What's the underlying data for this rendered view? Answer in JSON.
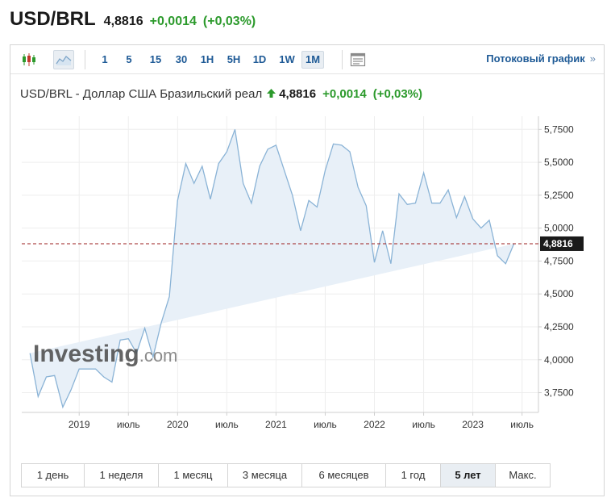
{
  "header": {
    "pair": "USD/BRL",
    "price": "4,8816",
    "change": "+0,0014",
    "change_pct": "(+0,03%)"
  },
  "toolbar": {
    "icons": [
      "candlestick-icon",
      "area-chart-icon"
    ],
    "active_icon": "area-chart-icon",
    "timeframes": [
      "1",
      "5",
      "15",
      "30",
      "1H",
      "5H",
      "1D",
      "1W",
      "1M"
    ],
    "active_timeframe": "1M",
    "settings_icon": "chart-settings-icon",
    "streaming_label": "Потоковый график",
    "streaming_chevron": "»"
  },
  "subtitle": {
    "name": "USD/BRL - Доллар США Бразильский реал",
    "arrow_icon": "up-arrow-icon",
    "price": "4,8816",
    "change": "+0,0014",
    "change_pct": "(+0,03%)"
  },
  "watermark": {
    "brand": "Investing",
    "suffix": ".com"
  },
  "ranges": {
    "items": [
      "1 день",
      "1 неделя",
      "1 месяц",
      "3 месяца",
      "6 месяцев",
      "1 год",
      "5 лет",
      "Макс."
    ],
    "active": "5 лет"
  },
  "colors": {
    "line": "#8ab3d6",
    "area": "#e8f0f8",
    "positive": "#2c9a2c",
    "link": "#1e5a96",
    "last_price_line": "#9b1c1c",
    "last_price_tag": "#1a1a1a"
  },
  "chart_data": {
    "type": "area",
    "ylim": [
      3.6,
      5.85
    ],
    "yticks": [
      3.75,
      4.0,
      4.25,
      4.5,
      4.75,
      5.0,
      5.25,
      5.5,
      5.75
    ],
    "ytick_labels": [
      "3,7500",
      "4,0000",
      "4,2500",
      "4,5000",
      "4,7500",
      "5,0000",
      "5,2500",
      "5,5000",
      "5,7500"
    ],
    "xlim": [
      "2018-06",
      "2023-09"
    ],
    "xticks": [
      {
        "label": "2019",
        "date": "2019-01"
      },
      {
        "label": "июль",
        "date": "2019-07"
      },
      {
        "label": "2020",
        "date": "2020-01"
      },
      {
        "label": "июль",
        "date": "2020-07"
      },
      {
        "label": "2021",
        "date": "2021-01"
      },
      {
        "label": "июль",
        "date": "2021-07"
      },
      {
        "label": "2022",
        "date": "2022-01"
      },
      {
        "label": "июль",
        "date": "2022-07"
      },
      {
        "label": "2023",
        "date": "2023-01"
      },
      {
        "label": "июль",
        "date": "2023-07"
      }
    ],
    "last_value": 4.8816,
    "last_value_label": "4,8816",
    "grid": true,
    "series": [
      {
        "dates": [
          "2018-07",
          "2018-08",
          "2018-09",
          "2018-10",
          "2018-11",
          "2018-12",
          "2019-01",
          "2019-02",
          "2019-03",
          "2019-04",
          "2019-05",
          "2019-06",
          "2019-07",
          "2019-08",
          "2019-09",
          "2019-10",
          "2019-11",
          "2019-12",
          "2020-01",
          "2020-02",
          "2020-03",
          "2020-04",
          "2020-05",
          "2020-06",
          "2020-07",
          "2020-08",
          "2020-09",
          "2020-10",
          "2020-11",
          "2020-12",
          "2021-01",
          "2021-02",
          "2021-03",
          "2021-04",
          "2021-05",
          "2021-06",
          "2021-07",
          "2021-08",
          "2021-09",
          "2021-10",
          "2021-11",
          "2021-12",
          "2022-01",
          "2022-02",
          "2022-03",
          "2022-04",
          "2022-05",
          "2022-06",
          "2022-07",
          "2022-08",
          "2022-09",
          "2022-10",
          "2022-11",
          "2022-12",
          "2023-01",
          "2023-02",
          "2023-03",
          "2023-04",
          "2023-05",
          "2023-06",
          "2023-07",
          "2023-08"
        ],
        "values": [
          4.05,
          3.72,
          3.87,
          3.88,
          3.64,
          3.77,
          3.93,
          3.93,
          3.93,
          3.87,
          3.83,
          4.15,
          4.16,
          4.05,
          4.24,
          4.02,
          4.28,
          4.48,
          5.21,
          5.49,
          5.34,
          5.47,
          5.22,
          5.49,
          5.58,
          5.75,
          5.34,
          5.19,
          5.47,
          5.6,
          5.63,
          5.44,
          5.25,
          4.98,
          5.21,
          5.16,
          5.44,
          5.64,
          5.63,
          5.58,
          5.31,
          5.17,
          4.74,
          4.98,
          4.73,
          5.26,
          5.18,
          5.19,
          5.42,
          5.19,
          5.19,
          5.29,
          5.08,
          5.24,
          5.07,
          5.0,
          5.06,
          4.79,
          4.73,
          4.88
        ]
      }
    ]
  }
}
